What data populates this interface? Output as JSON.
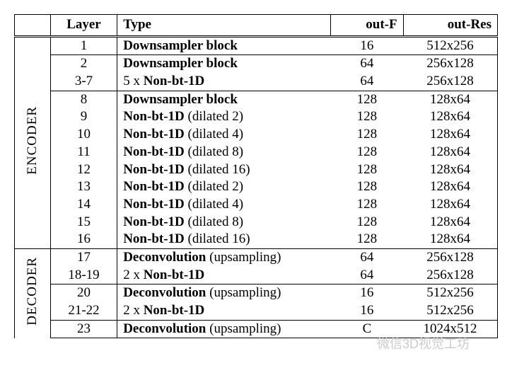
{
  "headers": {
    "col1": "",
    "col2": "Layer",
    "col3": "Type",
    "col4": "out-F",
    "col5": "out-Res"
  },
  "sections": {
    "encoder": {
      "label": "ENCODER",
      "rows": [
        {
          "layer": "1",
          "type_b": "Downsampler block",
          "type_n": "",
          "outf": "16",
          "outres": "512x256"
        },
        {
          "layer": "2",
          "type_b": "Downsampler block",
          "type_n": "",
          "outf": "64",
          "outres": "256x128"
        },
        {
          "layer": "3-7",
          "type_p": "5 x ",
          "type_b": "Non-bt-1D",
          "type_n": "",
          "outf": "64",
          "outres": "256x128"
        },
        {
          "layer": "8",
          "type_b": "Downsampler block",
          "type_n": "",
          "outf": "128",
          "outres": "128x64"
        },
        {
          "layer": "9",
          "type_b": "Non-bt-1D",
          "type_n": " (dilated 2)",
          "outf": "128",
          "outres": "128x64"
        },
        {
          "layer": "10",
          "type_b": "Non-bt-1D",
          "type_n": " (dilated 4)",
          "outf": "128",
          "outres": "128x64"
        },
        {
          "layer": "11",
          "type_b": "Non-bt-1D",
          "type_n": " (dilated 8)",
          "outf": "128",
          "outres": "128x64"
        },
        {
          "layer": "12",
          "type_b": "Non-bt-1D",
          "type_n": " (dilated 16)",
          "outf": "128",
          "outres": "128x64"
        },
        {
          "layer": "13",
          "type_b": "Non-bt-1D",
          "type_n": " (dilated 2)",
          "outf": "128",
          "outres": "128x64"
        },
        {
          "layer": "14",
          "type_b": "Non-bt-1D",
          "type_n": " (dilated 4)",
          "outf": "128",
          "outres": "128x64"
        },
        {
          "layer": "15",
          "type_b": "Non-bt-1D",
          "type_n": " (dilated 8)",
          "outf": "128",
          "outres": "128x64"
        },
        {
          "layer": "16",
          "type_b": "Non-bt-1D",
          "type_n": " (dilated 16)",
          "outf": "128",
          "outres": "128x64"
        }
      ]
    },
    "decoder": {
      "label": "DECODER",
      "rows": [
        {
          "layer": "17",
          "type_b": "Deconvolution",
          "type_n": " (upsampling)",
          "outf": "64",
          "outres": "256x128"
        },
        {
          "layer": "18-19",
          "type_p": "2 x ",
          "type_b": "Non-bt-1D",
          "type_n": "",
          "outf": "64",
          "outres": "256x128"
        },
        {
          "layer": "20",
          "type_b": "Deconvolution",
          "type_n": " (upsampling)",
          "outf": "16",
          "outres": "512x256"
        },
        {
          "layer": "21-22",
          "type_p": "2 x ",
          "type_b": "Non-bt-1D",
          "type_n": "",
          "outf": "16",
          "outres": "512x256"
        },
        {
          "layer": "23",
          "type_b": "Deconvolution",
          "type_n": " (upsampling)",
          "outf": "C",
          "outres": "1024x512"
        }
      ]
    }
  },
  "watermark": "微信3D视觉工坊"
}
